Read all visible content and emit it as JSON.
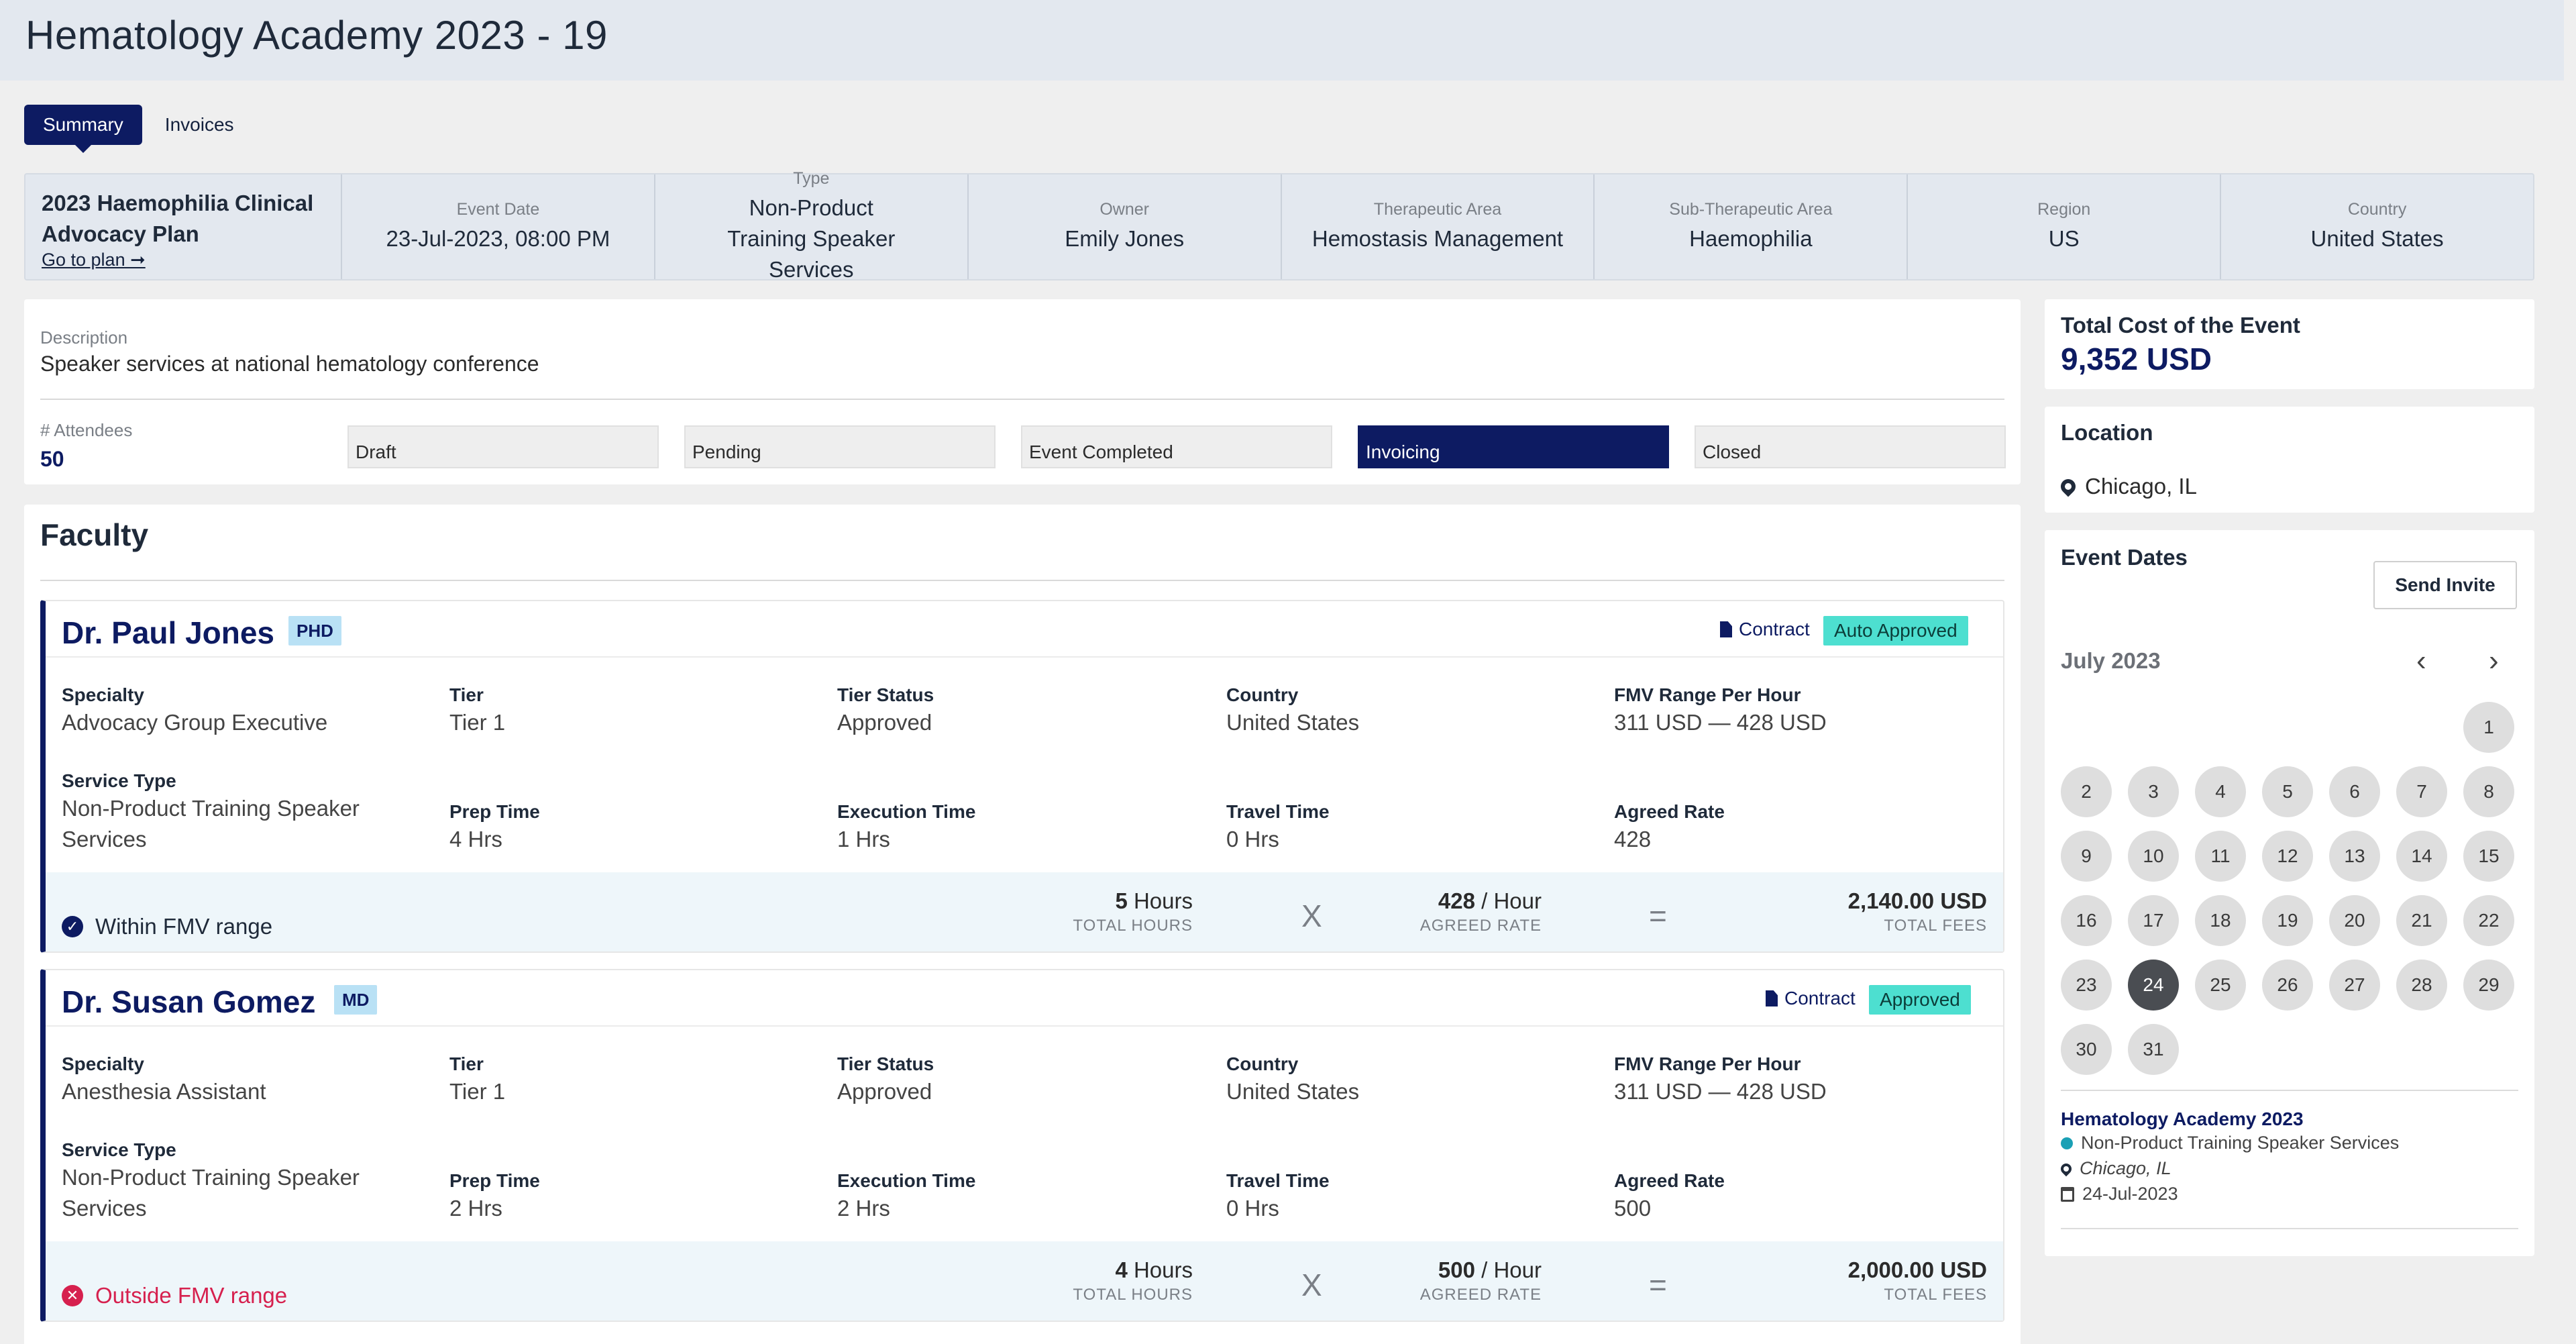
{
  "page": {
    "title": "Hematology Academy 2023 - 19"
  },
  "tabs": [
    {
      "label": "Summary"
    },
    {
      "label": "Invoices"
    }
  ],
  "summary": {
    "plan_name": "2023 Haemophilia Clinical Advocacy Plan",
    "plan_link": "Go to plan ➞",
    "cells": [
      {
        "label": "Event Date",
        "value": "23-Jul-2023, 08:00 PM"
      },
      {
        "label": "Type",
        "value": "Non-Product Training Speaker Services"
      },
      {
        "label": "Owner",
        "value": "Emily Jones"
      },
      {
        "label": "Therapeutic Area",
        "value": "Hemostasis Management"
      },
      {
        "label": "Sub-Therapeutic Area",
        "value": "Haemophilia"
      },
      {
        "label": "Region",
        "value": "US"
      },
      {
        "label": "Country",
        "value": "United States"
      }
    ]
  },
  "description": {
    "label": "Description",
    "text": "Speaker services at national hematology conference",
    "attendees_label": "# Attendees",
    "attendees_value": "50",
    "stages": [
      {
        "label": "Draft",
        "active": false
      },
      {
        "label": "Pending",
        "active": false
      },
      {
        "label": "Event Completed",
        "active": false
      },
      {
        "label": "Invoicing",
        "active": true
      },
      {
        "label": "Closed",
        "active": false
      }
    ]
  },
  "faculty": {
    "title": "Faculty",
    "field_labels": {
      "specialty": "Specialty",
      "tier": "Tier",
      "tier_status": "Tier Status",
      "country": "Country",
      "fmv_range": "FMV Range Per Hour",
      "service_type": "Service Type",
      "prep_time": "Prep Time",
      "execution_time": "Execution Time",
      "travel_time": "Travel Time",
      "agreed_rate": "Agreed Rate",
      "total_hours": "TOTAL HOURS",
      "agreed_rate_sub": "AGREED RATE",
      "total_fees": "TOTAL FEES",
      "hours_unit": "Hours",
      "hour_unit": "/  Hour",
      "currency": "USD",
      "times": "X",
      "equals": "="
    },
    "contract_label": "Contract",
    "members": [
      {
        "name": "Dr. Paul Jones",
        "degree": "PHD",
        "status": "Auto Approved",
        "specialty": "Advocacy Group Executive",
        "tier": "Tier 1",
        "tier_status": "Approved",
        "country": "United States",
        "fmv_range": "311 USD — 428 USD",
        "service_type": "Non-Product Training Speaker Services",
        "prep_time": "4 Hrs",
        "execution_time": "1 Hrs",
        "travel_time": "0 Hrs",
        "agreed_rate": "428",
        "fmv_status": "Within FMV range",
        "total_hours": "5",
        "rate": "428",
        "total_fees": "2,140.00"
      },
      {
        "name": "Dr. Susan Gomez",
        "degree": "MD",
        "status": "Approved",
        "specialty": "Anesthesia Assistant",
        "tier": "Tier 1",
        "tier_status": "Approved",
        "country": "United States",
        "fmv_range": "311 USD — 428 USD",
        "service_type": "Non-Product Training Speaker Services",
        "prep_time": "2 Hrs",
        "execution_time": "2 Hrs",
        "travel_time": "0 Hrs",
        "agreed_rate": "500",
        "fmv_status": "Outside FMV range",
        "total_hours": "4",
        "rate": "500",
        "total_fees": "2,000.00"
      }
    ]
  },
  "cost": {
    "label": "Total Cost of the Event",
    "value": "9,352 USD"
  },
  "location": {
    "label": "Location",
    "value": "Chicago, IL"
  },
  "event_dates": {
    "label": "Event Dates",
    "send_invite": "Send Invite",
    "month": "July 2023",
    "selected_day": "24",
    "days": [
      "1",
      "2",
      "3",
      "4",
      "5",
      "6",
      "7",
      "8",
      "9",
      "10",
      "11",
      "12",
      "13",
      "14",
      "15",
      "16",
      "17",
      "18",
      "19",
      "20",
      "21",
      "22",
      "23",
      "24",
      "25",
      "26",
      "27",
      "28",
      "29",
      "30",
      "31"
    ],
    "event": {
      "title": "Hematology Academy 2023",
      "type": "Non-Product Training Speaker Services",
      "location": "Chicago, IL",
      "date": "24-Jul-2023"
    }
  },
  "colors": {
    "navy": "#0d1b62",
    "approved": "#4ddfd0",
    "danger": "#d6204e"
  }
}
